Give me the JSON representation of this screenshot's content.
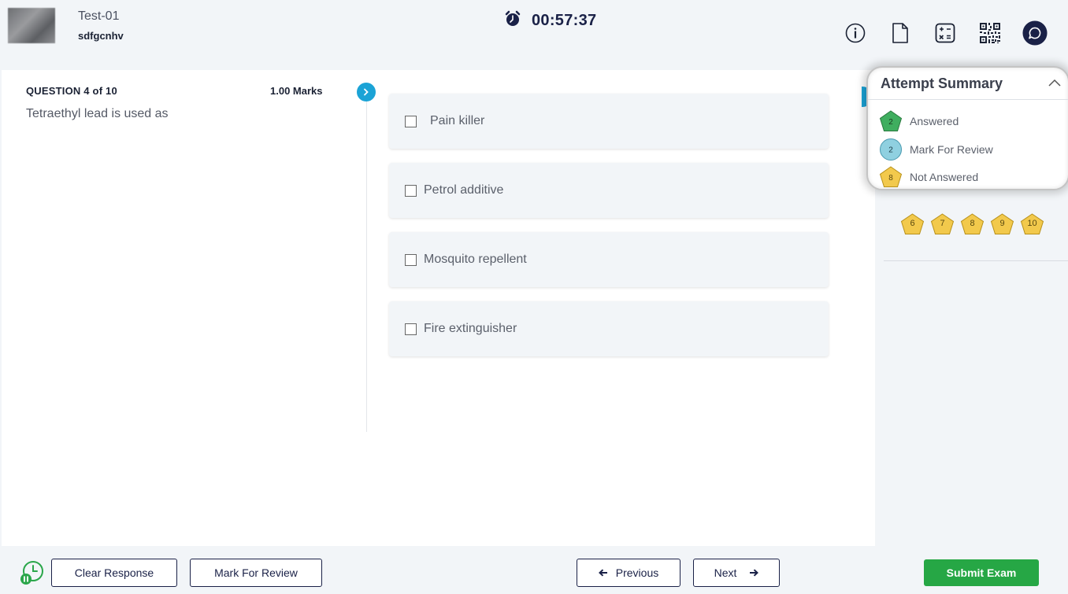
{
  "header": {
    "test_name": "Test-01",
    "user_name": "sdfgcnhv",
    "timer": "00:57:37",
    "icons": [
      "info-icon",
      "document-icon",
      "calculator-icon",
      "qr-code-icon",
      "chat-icon"
    ]
  },
  "question": {
    "number_label": "QUESTION 4 of 10",
    "marks": "1.00 Marks",
    "text": "Tetraethyl lead is used as",
    "options": [
      {
        "label": "Pain killer"
      },
      {
        "label": "Petrol additive"
      },
      {
        "label": "Mosquito repellent"
      },
      {
        "label": "Fire extinguisher"
      }
    ]
  },
  "summary": {
    "title": "Attempt Summary",
    "legend": [
      {
        "count": "2",
        "label": "Answered",
        "color": "#3fae5f"
      },
      {
        "count": "2",
        "label": "Mark For Review",
        "color": "#8fd0e0"
      },
      {
        "count": "8",
        "label": "Not Answered",
        "color": "#f2c94c"
      }
    ],
    "palette": [
      "6",
      "7",
      "8",
      "9",
      "10"
    ]
  },
  "footer": {
    "clear_label": "Clear Response",
    "review_label": "Mark For Review",
    "prev_label": "Previous",
    "next_label": "Next",
    "submit_label": "Submit Exam"
  }
}
